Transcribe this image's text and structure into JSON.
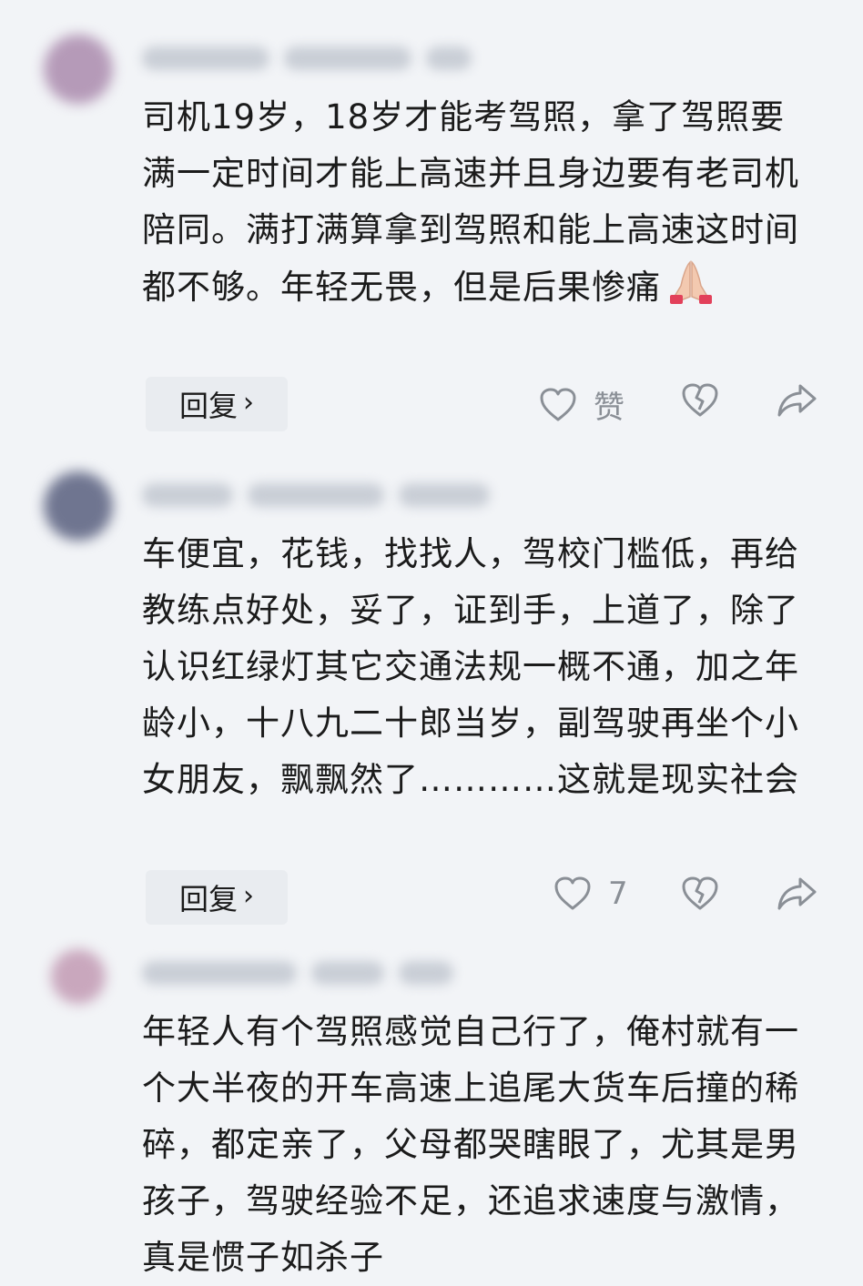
{
  "comments": [
    {
      "avatar_color": "#b59ab8",
      "text": "司机19岁，18岁才能考驾照，拿了驾照要满一定时间才能上高速并且身边要有老司机陪同。满打满算拿到驾照和能上高速这时间都不够。年轻无畏，但是后果惨痛",
      "emoji": "folded-hands",
      "reply_label": "回复",
      "like_label": "赞"
    },
    {
      "avatar_color": "#6f7590",
      "text": "车便宜，花钱，找找人，驾校门槛低，再给教练点好处，妥了，证到手，上道了，除了认识红绿灯其它交通法规一概不通，加之年龄小，十八九二十郎当岁，副驾驶再坐个小女朋友，飘飘然了…………这就是现实社会",
      "reply_label": "回复",
      "like_count": "7"
    },
    {
      "avatar_color": "#c9a7bd",
      "text": "年轻人有个驾照感觉自己行了，俺村就有一个大半夜的开车高速上追尾大货车后撞的稀碎，都定亲了，父母都哭瞎眼了，尤其是男孩子，驾驶经验不足，还追求速度与激情，真是惯子如杀子"
    }
  ],
  "icons": {
    "like": "heart-outline-icon",
    "dislike": "broken-heart-icon",
    "share": "share-arrow-icon",
    "reply_chevron": "chevron-right-icon"
  },
  "colors": {
    "background": "#f2f4f7",
    "text": "#1b1b1b",
    "muted": "#8a8f96",
    "reply_button_bg": "#e9ecf0"
  }
}
